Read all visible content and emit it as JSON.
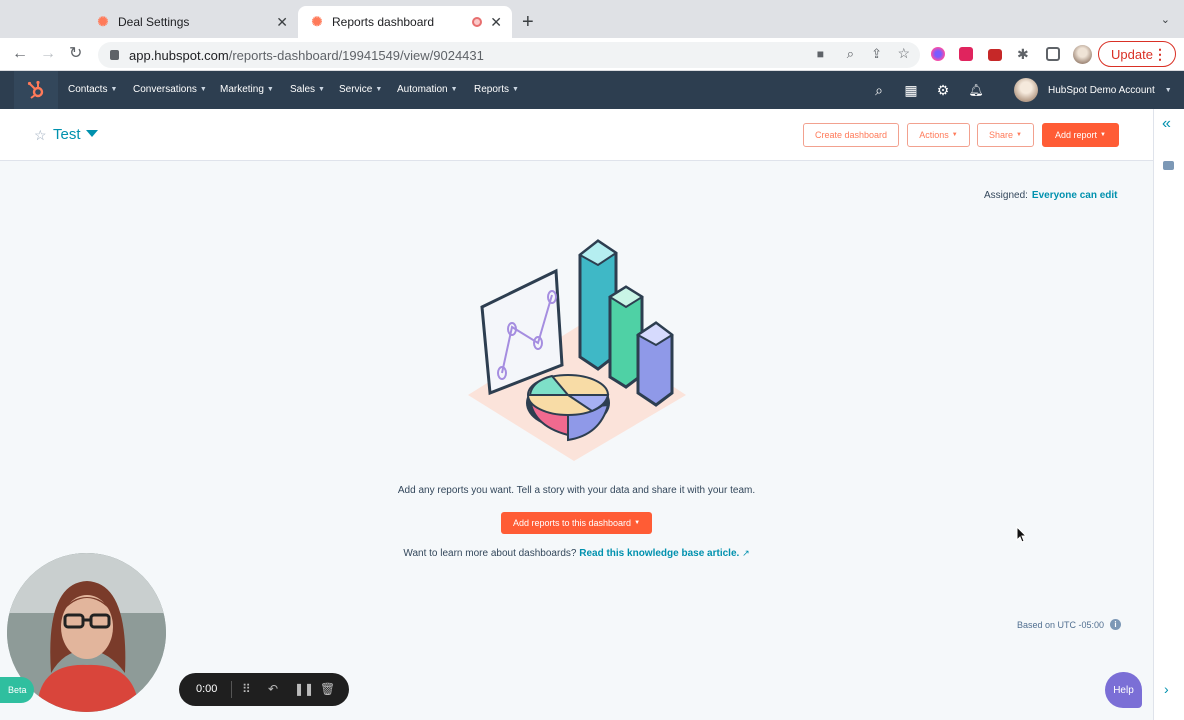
{
  "browser": {
    "tabs": [
      {
        "title": "Deal Settings",
        "active": false
      },
      {
        "title": "Reports dashboard",
        "active": true
      }
    ],
    "new_tab": "+",
    "url_host": "app.hubspot.com",
    "url_path": "/reports-dashboard/19941549/view/9024431",
    "update_label": "Update"
  },
  "hubspot_nav": {
    "items": [
      "Contacts",
      "Conversations",
      "Marketing",
      "Sales",
      "Service",
      "Automation",
      "Reports"
    ],
    "account_name": "HubSpot Demo Account"
  },
  "dashboard": {
    "name": "Test",
    "buttons": {
      "create": "Create dashboard",
      "actions": "Actions",
      "share": "Share",
      "add_report": "Add report"
    },
    "assigned_label": "Assigned:",
    "assigned_value": "Everyone can edit",
    "empty_message": "Add any reports you want. Tell a story with your data and share it with your team.",
    "add_reports_button": "Add reports to this dashboard",
    "learn_prefix": "Want to learn more about dashboards?",
    "learn_link": "Read this knowledge base article.",
    "timezone": "Based on UTC -05:00"
  },
  "help_label": "Help",
  "recorder": {
    "beta": "Beta",
    "time": "0:00"
  },
  "colors": {
    "nav_bg": "#2d3e50",
    "accent_orange": "#ff5c35",
    "link_teal": "#0091ae",
    "help_purple": "#7b6fd6"
  }
}
